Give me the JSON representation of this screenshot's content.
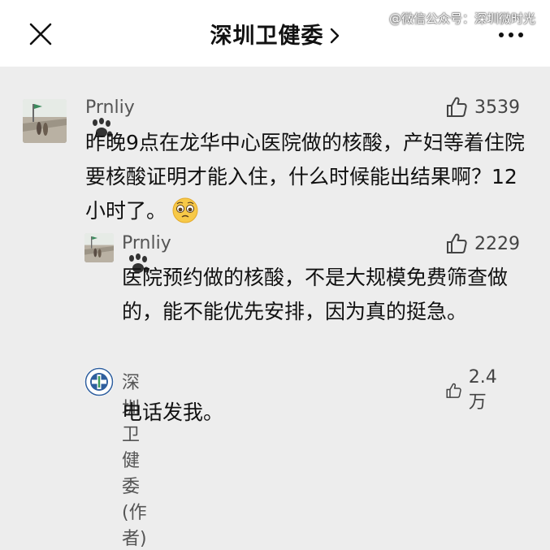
{
  "header": {
    "title": "深圳卫健委",
    "watermark": "@微信公众号：深圳微时光",
    "close_icon": "close-icon",
    "chevron_icon": "chevron-right-icon",
    "more_icon": "more-dots-icon"
  },
  "comments": [
    {
      "user": "Prnliy",
      "likes": "3539",
      "text": "昨晚9点在龙华中心医院做的核酸，产妇等着住院要核酸证明才能入住，什么时候能出结果啊？12小时了。",
      "emoji": "pleading-face"
    },
    {
      "user": "Prnliy",
      "likes": "2229",
      "text": "医院预约做的核酸，不是大规模免费筛查做的，能不能优先安排，因为真的挺急。"
    },
    {
      "user": "深圳卫健委(作者)",
      "likes": "2.4万",
      "text": "电话发我。"
    }
  ],
  "colors": {
    "background": "#ededed",
    "header": "#ffffff",
    "name": "#555555",
    "text": "#111111"
  }
}
